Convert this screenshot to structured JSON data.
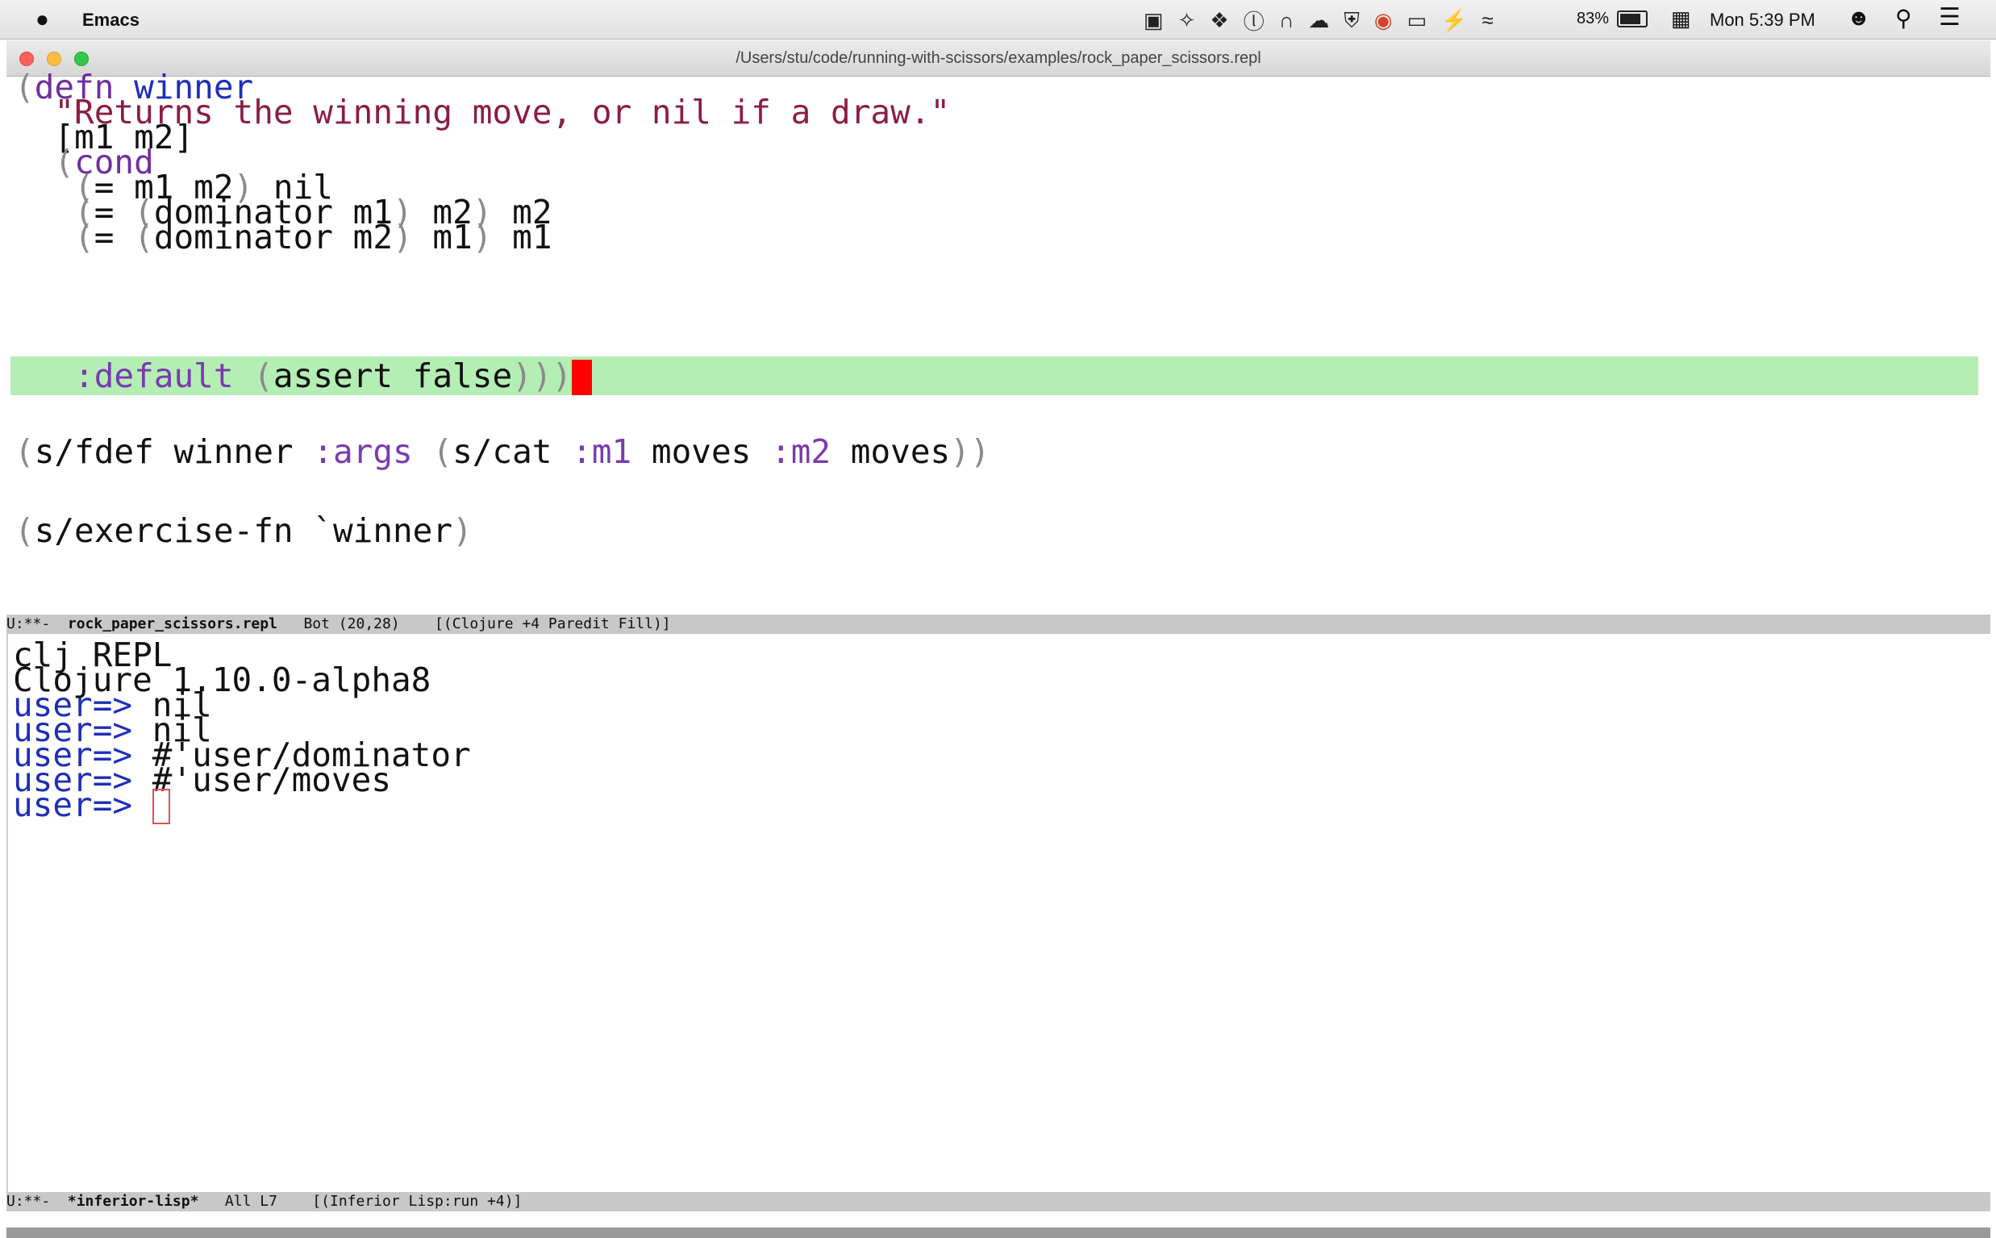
{
  "menubar": {
    "apple_glyph": "",
    "app_name": "Emacs",
    "battery_text": "83%",
    "battery_level": 0.83,
    "clock": "Mon 5:39 PM",
    "status_icons": [
      "camera-icon",
      "crosshair-icon",
      "dropbox-icon",
      "onepassword-icon",
      "lock-icon",
      "cloud-icon",
      "shield-icon",
      "chrome-icon",
      "airplay-icon",
      "bolt-icon",
      "wifi-icon"
    ]
  },
  "window": {
    "title": "/Users/stu/code/running-with-scissors/examples/rock_paper_scissors.repl"
  },
  "editor": {
    "lines": {
      "l1": {
        "p1": "(",
        "kw": "defn",
        "sp": " ",
        "fn": "winner"
      },
      "l2": {
        "str": "  \"Returns the winning move, or nil if a draw.\""
      },
      "l3": {
        "text": "  [m1 m2]"
      },
      "l4": {
        "ind": "  ",
        "p1": "(",
        "kw": "cond"
      },
      "l5": {
        "ind": "   ",
        "p1": "(",
        "t1": "= m1 m2",
        "p2": ")",
        "t2": " nil"
      },
      "l6": {
        "ind": "   ",
        "p1": "(",
        "t1": "= ",
        "p2": "(",
        "t2": "dominator m1",
        "p3": ")",
        "t3": " m2",
        "p4": ")",
        "t4": " m2"
      },
      "l7": {
        "ind": "   ",
        "p1": "(",
        "t1": "= ",
        "p2": "(",
        "t2": "dominator m2",
        "p3": ")",
        "t3": " m1",
        "p4": ")",
        "t4": " m1"
      },
      "l8": {
        "ind": "   ",
        "kw": ":default",
        "sp": " ",
        "p1": "(",
        "t1": "assert false",
        "p2": ")))"
      },
      "l9": {
        "p1": "(",
        "t1": "s/fdef winner ",
        "k1": ":args",
        "sp": " ",
        "p2": "(",
        "t2": "s/cat ",
        "k2": ":m1",
        "t3": " moves ",
        "k3": ":m2",
        "t4": " moves",
        "p3": "))"
      },
      "l10": {
        "p1": "(",
        "t1": "s/exercise-fn `winner",
        "p2": ")"
      }
    }
  },
  "modeline_top": {
    "flags": "U:**-  ",
    "buffer": "rock_paper_scissors.repl",
    "position": "   Bot (20,28)    ",
    "modes": "[(Clojure +4 Paredit Fill)]"
  },
  "repl": {
    "line1": "clj REPL",
    "line2": "Clojure 1.10.0-alpha8",
    "prompt": "user=>",
    "outputs": [
      " nil",
      " nil",
      " #'user/dominator",
      " #'user/moves"
    ]
  },
  "modeline_bottom": {
    "flags": "U:**-  ",
    "buffer": "*inferior-lisp*",
    "position": "   All L7    ",
    "modes": "[(Inferior Lisp:run +4)]"
  }
}
